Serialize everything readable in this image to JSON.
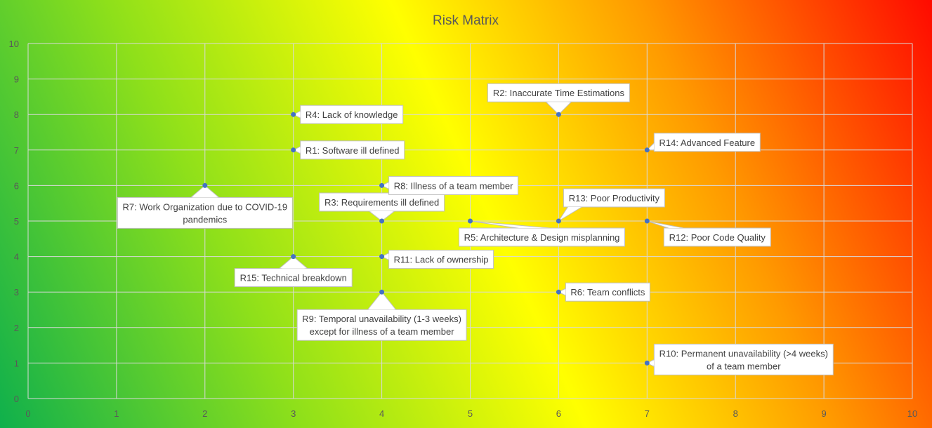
{
  "chart_data": {
    "type": "scatter",
    "title": "Risk Matrix",
    "xlabel": "",
    "ylabel": "",
    "xlim": [
      0,
      10
    ],
    "ylim": [
      0,
      10
    ],
    "x_ticks": [
      "0",
      "1",
      "2",
      "3",
      "4",
      "5",
      "6",
      "7",
      "8",
      "9",
      "10"
    ],
    "y_ticks": [
      "0",
      "1",
      "2",
      "3",
      "4",
      "5",
      "6",
      "7",
      "8",
      "9",
      "10"
    ],
    "grid": true,
    "legend": "none",
    "background": "diagonal gradient green (bottom-left) through yellow to red (top-right)",
    "colors": {
      "gradient_green": "#0fb04c",
      "gradient_lime": "#8fe01a",
      "gradient_yellow": "#ffff00",
      "gradient_orange": "#ff9a00",
      "gradient_red": "#ff0a00",
      "marker": "#4472c4",
      "title": "#595959",
      "tick_text": "#595959",
      "callout_border": "#bfbfbf"
    },
    "points": [
      {
        "id": "R1",
        "x": 3,
        "y": 7,
        "label": [
          "R1: Software ill defined"
        ]
      },
      {
        "id": "R2",
        "x": 6,
        "y": 8,
        "label": [
          "R2: Inaccurate Time Estimations"
        ]
      },
      {
        "id": "R3",
        "x": 4,
        "y": 5,
        "label": [
          "R3: Requirements ill defined"
        ]
      },
      {
        "id": "R4",
        "x": 3,
        "y": 8,
        "label": [
          "R4: Lack of knowledge"
        ]
      },
      {
        "id": "R5",
        "x": 5,
        "y": 5,
        "label": [
          "R5: Architecture & Design misplanning"
        ]
      },
      {
        "id": "R6",
        "x": 6,
        "y": 3,
        "label": [
          "R6: Team conflicts"
        ]
      },
      {
        "id": "R7",
        "x": 2,
        "y": 6,
        "label": [
          "R7: Work Organization due to COVID-19",
          "pandemics"
        ]
      },
      {
        "id": "R8",
        "x": 4,
        "y": 6,
        "label": [
          "R8: Illness of a team member"
        ]
      },
      {
        "id": "R9",
        "x": 4,
        "y": 3,
        "label": [
          "R9: Temporal unavailability (1-3 weeks)",
          "except for illness of a team member"
        ]
      },
      {
        "id": "R10",
        "x": 7,
        "y": 1,
        "label": [
          "R10: Permanent unavailability (>4 weeks)",
          "of a team member"
        ]
      },
      {
        "id": "R11",
        "x": 4,
        "y": 4,
        "label": [
          "R11: Lack of ownership"
        ]
      },
      {
        "id": "R12",
        "x": 7,
        "y": 5,
        "label": [
          "R12: Poor Code Quality"
        ]
      },
      {
        "id": "R13",
        "x": 6,
        "y": 5,
        "label": [
          "R13: Poor Productivity"
        ]
      },
      {
        "id": "R14",
        "x": 7,
        "y": 7,
        "label": [
          "R14: Advanced Feature"
        ]
      },
      {
        "id": "R15",
        "x": 3,
        "y": 4,
        "label": [
          "R15: Technical breakdown"
        ]
      }
    ]
  }
}
